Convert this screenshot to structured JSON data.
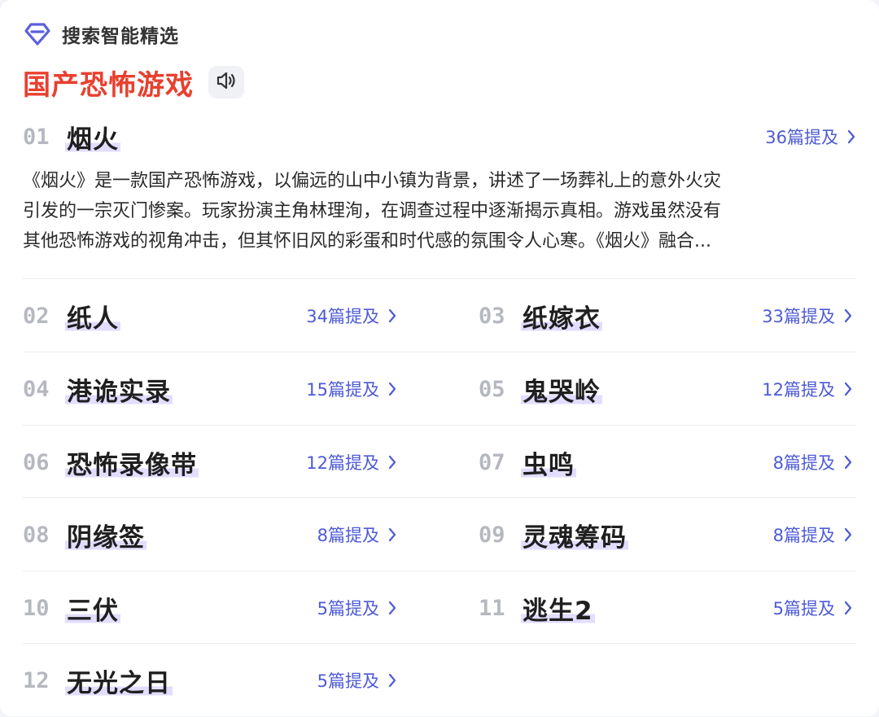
{
  "header": {
    "label": "搜索智能精选",
    "logo_icon": "diamond-icon",
    "accent": "#5b5fe0"
  },
  "title": {
    "text": "国产恐怖游戏",
    "color": "#e8402f",
    "speaker_icon": "speaker-icon"
  },
  "top": {
    "rank": "01",
    "name": "烟火",
    "mention": "36篇提及",
    "description": [
      "《烟火》是一款国产恐怖游戏，以偏远的山中小镇为背景，讲述了一场葬礼上的意外火灾",
      "引发的一宗灭门惨案。玩家扮演主角林理洵，在调查过程中逐渐揭示真相。游戏虽然没有",
      "其他恐怖游戏的视角冲击，但其怀旧风的彩蛋和时代感的氛围令人心寒。《烟火》融合..."
    ]
  },
  "items": [
    {
      "rank": "02",
      "name": "纸人",
      "mention": "34篇提及"
    },
    {
      "rank": "03",
      "name": "纸嫁衣",
      "mention": "33篇提及"
    },
    {
      "rank": "04",
      "name": "港诡实录",
      "mention": "15篇提及"
    },
    {
      "rank": "05",
      "name": "鬼哭岭",
      "mention": "12篇提及"
    },
    {
      "rank": "06",
      "name": "恐怖录像带",
      "mention": "12篇提及"
    },
    {
      "rank": "07",
      "name": "虫鸣",
      "mention": "8篇提及"
    },
    {
      "rank": "08",
      "name": "阴缘签",
      "mention": "8篇提及"
    },
    {
      "rank": "09",
      "name": "灵魂筹码",
      "mention": "8篇提及"
    },
    {
      "rank": "10",
      "name": "三伏",
      "mention": "5篇提及"
    },
    {
      "rank": "11",
      "name": "逃生2",
      "mention": "5篇提及"
    },
    {
      "rank": "12",
      "name": "无光之日",
      "mention": "5篇提及"
    }
  ],
  "colors": {
    "link": "#4d5ad6",
    "rank": "#b6b8c0",
    "highlight": "#927aff"
  }
}
